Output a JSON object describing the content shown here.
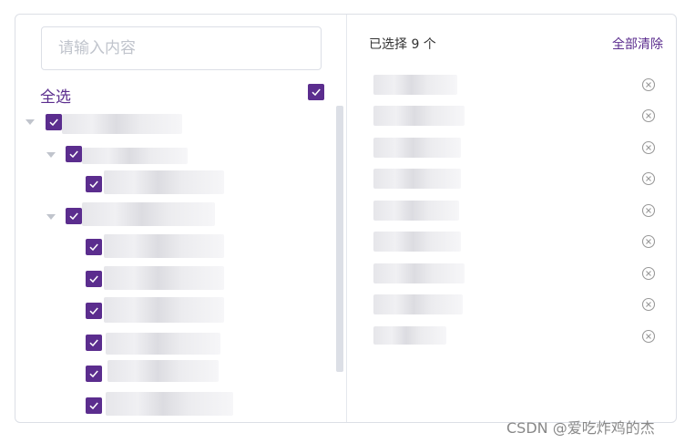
{
  "search": {
    "placeholder": "请输入内容",
    "value": ""
  },
  "left": {
    "select_all_label": "全选",
    "nodes": [
      {
        "label": "",
        "level": 0,
        "checked": true,
        "expanded": true
      },
      {
        "label": "",
        "level": 1,
        "checked": true,
        "expanded": true
      },
      {
        "label": "",
        "level": 2,
        "checked": true
      },
      {
        "label": "",
        "level": 1,
        "checked": true,
        "expanded": true
      },
      {
        "label": "",
        "level": 2,
        "checked": true
      },
      {
        "label": "",
        "level": 2,
        "checked": true
      },
      {
        "label": "",
        "level": 2,
        "checked": true
      },
      {
        "label": "",
        "level": 2,
        "checked": true
      },
      {
        "label": "",
        "level": 2,
        "checked": true
      },
      {
        "label": "",
        "level": 2,
        "checked": true
      }
    ]
  },
  "right": {
    "selected_count_text": "已选择 9 个",
    "clear_all_label": "全部清除",
    "items": [
      "",
      "",
      "",
      "",
      "",
      "",
      "",
      "",
      ""
    ]
  },
  "colors": {
    "accent": "#5b2d8e",
    "border": "#dcdfe6"
  },
  "watermark": "CSDN @爱吃炸鸡的杰"
}
